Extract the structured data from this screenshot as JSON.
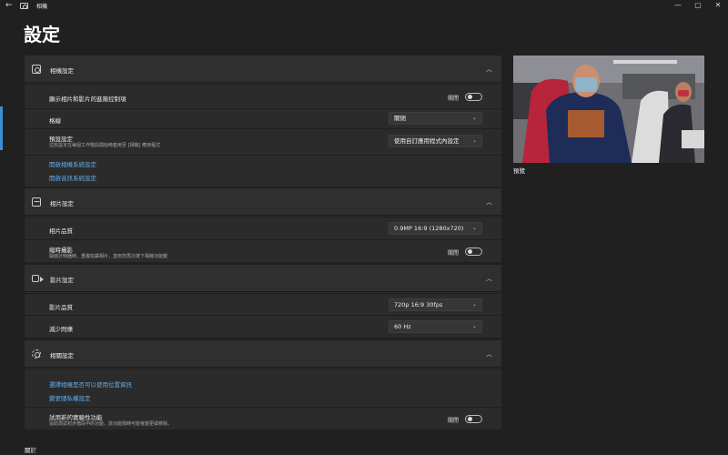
{
  "window": {
    "app_title": "相機",
    "back_icon": "back-arrow-icon",
    "app_icon": "camera-app-icon",
    "controls": [
      "minimize-icon",
      "maximize-icon",
      "close-icon"
    ],
    "minimize_glyph": "—",
    "maximize_glyph": "▢",
    "close_glyph": "✕",
    "back_glyph": "←"
  },
  "page_title": "設定",
  "accent_color": "#3a8fd8",
  "link_color": "#5eaef0",
  "chevron_up": "︿",
  "chevron_down": "⌄",
  "sections": {
    "camera": {
      "title": "相機設定",
      "icon": "camera-icon",
      "advanced_label": "顯示相片和影片的進階控制項",
      "advanced_toggle": "關閉",
      "grid_label": "格線",
      "grid_value": "關閉",
      "default_label": "預設設定",
      "default_sub": "這些設定在每個工作階段開始時套用至 [相機] 應用程式",
      "default_value": "使用自訂應用程式內設定",
      "link_camera": "開啟相機系統設定",
      "link_audio": "開啟音訊系統設定"
    },
    "photo": {
      "title": "相片設定",
      "icon": "photo-icon",
      "quality_label": "相片品質",
      "quality_value": "0.9MP 16:9 (1280x720)",
      "timelapse_label": "縮時攝影",
      "timelapse_sub": "開啟計時器時，重複拍攝相片，直到您再次按下相機功能鍵",
      "timelapse_toggle": "關閉"
    },
    "video": {
      "title": "影片設定",
      "icon": "video-icon",
      "quality_label": "影片品質",
      "quality_value": "720p 16:9 30fps",
      "flicker_label": "減少閃爍",
      "flicker_value": "60 Hz"
    },
    "related": {
      "title": "相關設定",
      "icon": "gear-icon",
      "link_location": "選擇相機是否可以使用位置資訊",
      "link_privacy": "變更隱私權設定",
      "experimental_label": "試用新的實驗性功能",
      "experimental_sub": "協助測試初步階段中的功能，該功能隨時可能會變更或移除。",
      "experimental_toggle": "關閉"
    }
  },
  "preview": {
    "label": "預覽"
  },
  "about": {
    "label": "關於"
  }
}
